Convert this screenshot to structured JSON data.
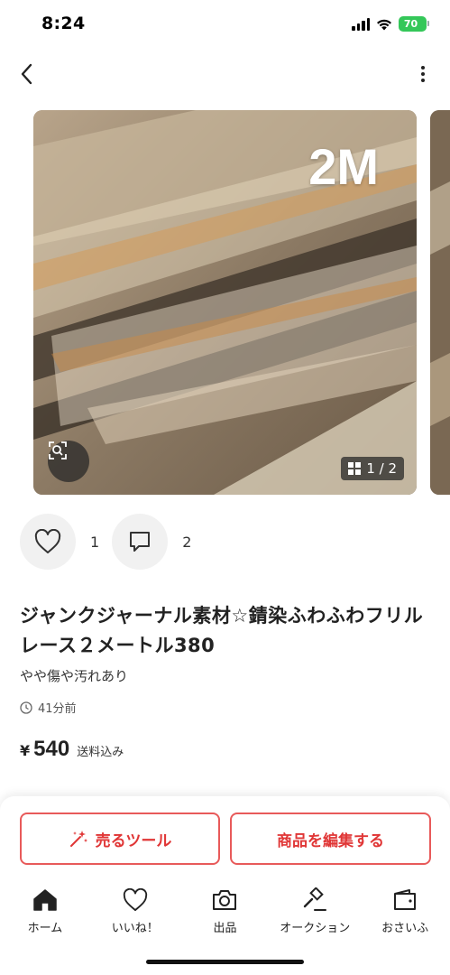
{
  "status_bar": {
    "time": "8:24",
    "battery": "70"
  },
  "header": {
    "back_icon": "chevron-left-icon",
    "more_icon": "vertical-ellipsis-icon"
  },
  "gallery": {
    "photo_text": "2M",
    "counter": "1 / 2",
    "zoom_icon": "zoom-scan-icon"
  },
  "reactions": {
    "likes": "1",
    "comments": "2"
  },
  "item": {
    "title": "ジャンクジャーナル素材☆錆染ふわふわフリルレース２メートル380",
    "condition": "やや傷や汚れあり",
    "posted": "41分前",
    "price_symbol": "¥",
    "price": "540",
    "shipping_note": "送料込み"
  },
  "actions": {
    "sell_tool_label": "売るツール",
    "edit_label": "商品を編集する"
  },
  "tabs": [
    {
      "label": "ホーム",
      "icon": "home-icon"
    },
    {
      "label": "いいね！",
      "icon": "heart-icon"
    },
    {
      "label": "出品",
      "icon": "camera-icon"
    },
    {
      "label": "オークション",
      "icon": "gavel-icon"
    },
    {
      "label": "おさいふ",
      "icon": "wallet-icon"
    }
  ],
  "colors": {
    "accent": "#e03636",
    "battery": "#34c759"
  }
}
